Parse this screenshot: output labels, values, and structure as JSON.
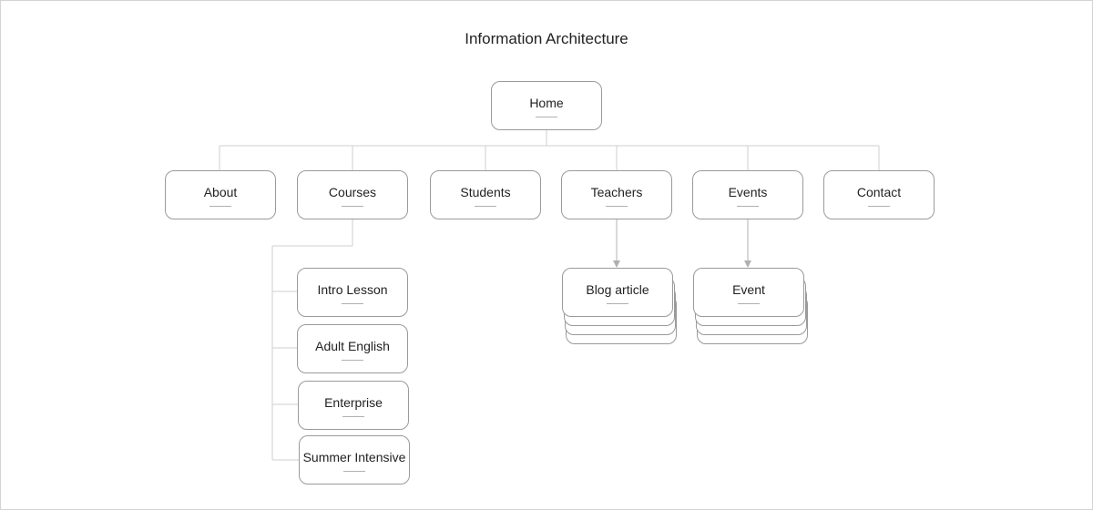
{
  "diagram": {
    "title": "Information Architecture",
    "root": {
      "label": "Home"
    },
    "level1": [
      {
        "id": "about",
        "label": "About"
      },
      {
        "id": "courses",
        "label": "Courses"
      },
      {
        "id": "students",
        "label": "Students"
      },
      {
        "id": "teachers",
        "label": "Teachers"
      },
      {
        "id": "events",
        "label": "Events"
      },
      {
        "id": "contact",
        "label": "Contact"
      }
    ],
    "courses_children": [
      {
        "label": "Intro Lesson"
      },
      {
        "label": "Adult English"
      },
      {
        "label": "Enterprise"
      },
      {
        "label": "Summer Intensive"
      }
    ],
    "teachers_child": {
      "label": "Blog article",
      "stacked": true
    },
    "events_child": {
      "label": "Event",
      "stacked": true
    }
  }
}
